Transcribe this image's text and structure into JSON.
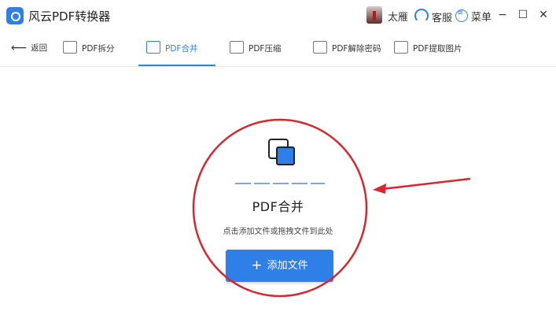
{
  "window": {
    "title": "风云PDF转换器",
    "user_name": "太雁",
    "service_label": "客服",
    "menu_label": "菜单",
    "minimize": "−",
    "maximize": "☐",
    "close": "✕"
  },
  "nav": {
    "back_label": "返回",
    "tabs": [
      {
        "label": "PDF拆分",
        "icon": "split-icon"
      },
      {
        "label": "PDF合并",
        "icon": "merge-icon",
        "active": true
      },
      {
        "label": "PDF压缩",
        "icon": "compress-icon"
      },
      {
        "label": "PDF解除密码",
        "icon": "lock-icon"
      },
      {
        "label": "PDF提取图片",
        "icon": "image-icon"
      }
    ]
  },
  "main": {
    "function_title": "PDF合并",
    "hint": "点击添加文件或拖拽文件到此处",
    "add_button_plus": "+",
    "add_button_label": "添加文件"
  },
  "colors": {
    "accent": "#2f7fe8",
    "annotation": "#d9262c"
  }
}
